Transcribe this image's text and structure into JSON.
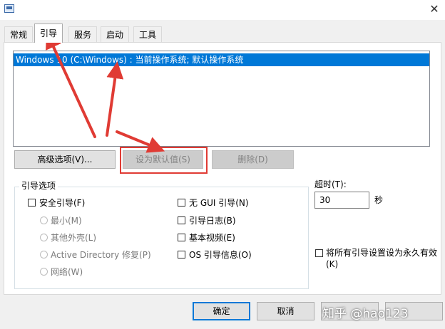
{
  "window": {
    "close_glyph": "✕"
  },
  "tabs": [
    {
      "label": "常规"
    },
    {
      "label": "引导"
    },
    {
      "label": "服务"
    },
    {
      "label": "启动"
    },
    {
      "label": "工具"
    }
  ],
  "os_list": {
    "items": [
      "Windows 10 (C:\\Windows) : 当前操作系统; 默认操作系统"
    ]
  },
  "buttons": {
    "advanced": "高级选项(V)...",
    "set_default": "设为默认值(S)",
    "delete": "删除(D)",
    "ok": "确定",
    "cancel": "取消"
  },
  "boot_options": {
    "legend": "引导选项",
    "safe_boot": "安全引导(F)",
    "minimal": "最小(M)",
    "alternate_shell": "其他外壳(L)",
    "active_directory": "Active Directory 修复(P)",
    "network": "网络(W)",
    "no_gui": "无 GUI 引导(N)",
    "boot_log": "引导日志(B)",
    "base_video": "基本视频(E)",
    "os_info": "OS 引导信息(O)"
  },
  "timeout": {
    "label": "超时(T):",
    "value": "30",
    "unit": "秒"
  },
  "permanent": {
    "line1": "将所有引导设置设为永久有效",
    "line2": "(K)"
  },
  "watermark": "知乎 @hao123",
  "colors": {
    "selection": "#0078d7",
    "annotation_red": "#e03b34",
    "dialog_bg": "#f0f0f0"
  }
}
